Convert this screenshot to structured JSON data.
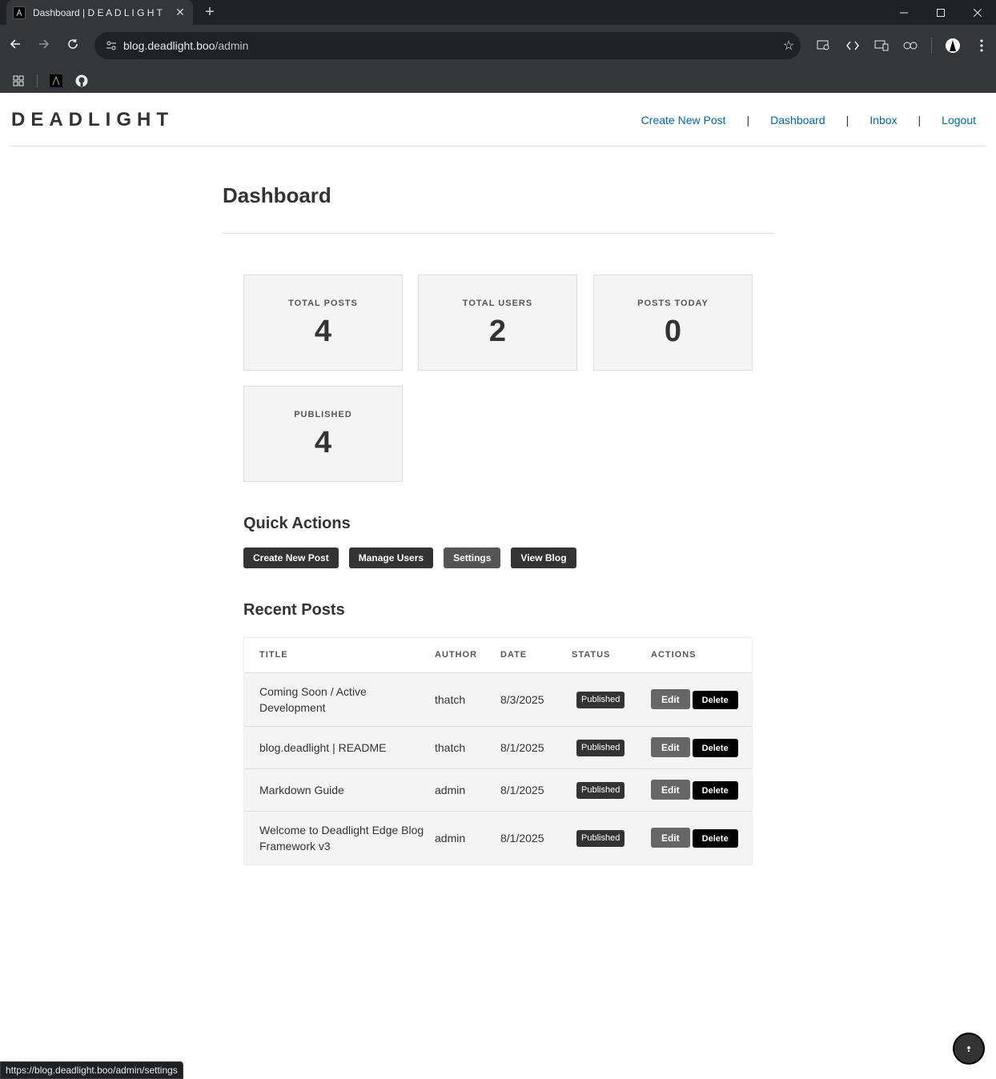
{
  "browser": {
    "tab_title": "Dashboard | D E A D L I G H T",
    "url_host": "blog.deadlight.boo",
    "url_path": "/admin",
    "new_tab": "+",
    "close_tab": "✕"
  },
  "site": {
    "brand": "DEADLIGHT",
    "nav": [
      "Create New Post",
      "Dashboard",
      "Inbox",
      "Logout"
    ],
    "nav_separator": "|"
  },
  "dashboard": {
    "title": "Dashboard",
    "stats": [
      {
        "label": "TOTAL POSTS",
        "value": "4"
      },
      {
        "label": "TOTAL USERS",
        "value": "2"
      },
      {
        "label": "POSTS TODAY",
        "value": "0"
      },
      {
        "label": "PUBLISHED",
        "value": "4"
      }
    ]
  },
  "quick_actions": {
    "title": "Quick Actions",
    "buttons": [
      "Create New Post",
      "Manage Users",
      "Settings",
      "View Blog"
    ]
  },
  "recent_posts": {
    "title": "Recent Posts",
    "columns": [
      "TITLE",
      "AUTHOR",
      "DATE",
      "STATUS",
      "ACTIONS"
    ],
    "rows": [
      {
        "title": "Coming Soon / Active Development",
        "author": "thatch",
        "date": "8/3/2025",
        "status": "Published",
        "edit": "Edit",
        "delete": "Delete"
      },
      {
        "title": "blog.deadlight | README",
        "author": "thatch",
        "date": "8/1/2025",
        "status": "Published",
        "edit": "Edit",
        "delete": "Delete"
      },
      {
        "title": "Markdown Guide",
        "author": "admin",
        "date": "8/1/2025",
        "status": "Published",
        "edit": "Edit",
        "delete": "Delete"
      },
      {
        "title": "Welcome to Deadlight Edge Blog Framework v3",
        "author": "admin",
        "date": "8/1/2025",
        "status": "Published",
        "edit": "Edit",
        "delete": "Delete"
      }
    ]
  },
  "status_bar": {
    "hover_url": "https://blog.deadlight.boo/admin/settings"
  }
}
